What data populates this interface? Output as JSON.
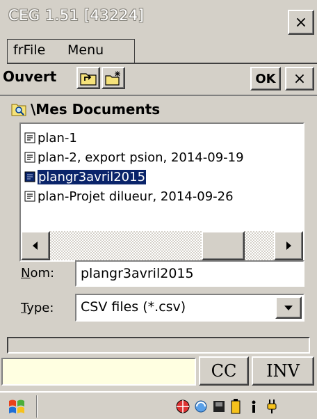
{
  "window": {
    "title": "CEG 1.51 [43224]",
    "close_label": "×"
  },
  "menu": {
    "items": [
      "frFile",
      "Menu"
    ]
  },
  "toolbar": {
    "title": "Ouvert",
    "ok_label": "OK",
    "cancel_label": "×",
    "icons": [
      "folder-up-icon",
      "new-folder-icon"
    ]
  },
  "path": {
    "text": "\\Mes Documents",
    "icon": "search-folder-icon"
  },
  "files": [
    {
      "name": "plan-1",
      "selected": false
    },
    {
      "name": "plan-2, export psion, 2014-09-19",
      "selected": false
    },
    {
      "name": "plangr3avril2015",
      "selected": true
    },
    {
      "name": "plan-Projet dilueur, 2014-09-26",
      "selected": false
    }
  ],
  "form": {
    "name_label_accel": "N",
    "name_label_rest": "om:",
    "name_value": "plangr3avril2015",
    "type_label_accel": "T",
    "type_label_rest": "ype:",
    "type_value": "CSV files (*.csv)"
  },
  "commands": {
    "input_value": "",
    "cc_label": "CC",
    "inv_label": "INV"
  },
  "taskbar": {
    "start_icon": "windows-flag-icon",
    "tray_icons": [
      "network-globe-icon",
      "sync-icon",
      "storage-card-icon",
      "battery-icon",
      "info-icon",
      "power-plug-icon"
    ]
  },
  "colors": {
    "selection": "#0a246a",
    "command_bg": "#ffffe1",
    "chrome": "#d4d0c8"
  }
}
